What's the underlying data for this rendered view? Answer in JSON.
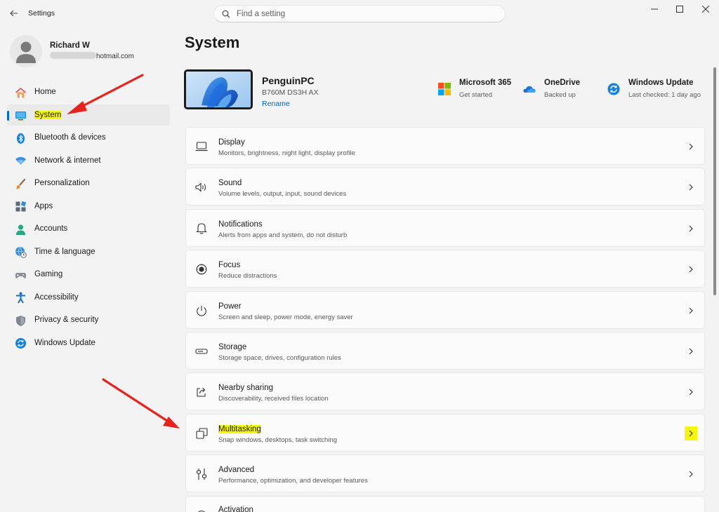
{
  "app": {
    "title": "Settings"
  },
  "search": {
    "placeholder": "Find a setting",
    "value": ""
  },
  "user": {
    "name": "Richard W",
    "email_suffix": "hotmail.com"
  },
  "sidebar": {
    "items": [
      {
        "label": "Home",
        "icon": "home-icon",
        "active": false
      },
      {
        "label": "System",
        "icon": "system-icon",
        "active": true
      },
      {
        "label": "Bluetooth & devices",
        "icon": "bluetooth-icon",
        "active": false
      },
      {
        "label": "Network & internet",
        "icon": "wifi-icon",
        "active": false
      },
      {
        "label": "Personalization",
        "icon": "brush-icon",
        "active": false
      },
      {
        "label": "Apps",
        "icon": "apps-icon",
        "active": false
      },
      {
        "label": "Accounts",
        "icon": "accounts-icon",
        "active": false
      },
      {
        "label": "Time & language",
        "icon": "globe-clock-icon",
        "active": false
      },
      {
        "label": "Gaming",
        "icon": "gamepad-icon",
        "active": false
      },
      {
        "label": "Accessibility",
        "icon": "accessibility-icon",
        "active": false
      },
      {
        "label": "Privacy & security",
        "icon": "shield-icon",
        "active": false
      },
      {
        "label": "Windows Update",
        "icon": "update-icon",
        "active": false
      }
    ]
  },
  "main": {
    "title": "System",
    "device": {
      "name": "PenguinPC",
      "model": "B760M DS3H AX",
      "rename_label": "Rename"
    },
    "quick_links": [
      {
        "title": "Microsoft 365",
        "subtitle": "Get started",
        "icon": "microsoft-365-icon"
      },
      {
        "title": "OneDrive",
        "subtitle": "Backed up",
        "icon": "onedrive-icon"
      },
      {
        "title": "Windows Update",
        "subtitle": "Last checked: 1 day ago",
        "icon": "windows-update-icon"
      }
    ],
    "cards": [
      {
        "title": "Display",
        "subtitle": "Monitors, brightness, night light, display profile",
        "icon": "display-icon"
      },
      {
        "title": "Sound",
        "subtitle": "Volume levels, output, input, sound devices",
        "icon": "speaker-icon"
      },
      {
        "title": "Notifications",
        "subtitle": "Alerts from apps and system, do not disturb",
        "icon": "bell-icon"
      },
      {
        "title": "Focus",
        "subtitle": "Reduce distractions",
        "icon": "focus-icon"
      },
      {
        "title": "Power",
        "subtitle": "Screen and sleep, power mode, energy saver",
        "icon": "power-icon"
      },
      {
        "title": "Storage",
        "subtitle": "Storage space, drives, configuration rules",
        "icon": "storage-icon"
      },
      {
        "title": "Nearby sharing",
        "subtitle": "Discoverability, received files location",
        "icon": "share-icon"
      },
      {
        "title": "Multitasking",
        "subtitle": "Snap windows, desktops, task switching",
        "icon": "multitasking-icon",
        "highlighted": true
      },
      {
        "title": "Advanced",
        "subtitle": "Performance, optimization, and developer features",
        "icon": "advanced-icon"
      },
      {
        "title": "Activation",
        "subtitle": "",
        "icon": "activation-icon"
      }
    ]
  },
  "colors": {
    "accent": "#0067c0",
    "highlight": "#f7f70a",
    "annotation_arrow": "#e8231d"
  }
}
